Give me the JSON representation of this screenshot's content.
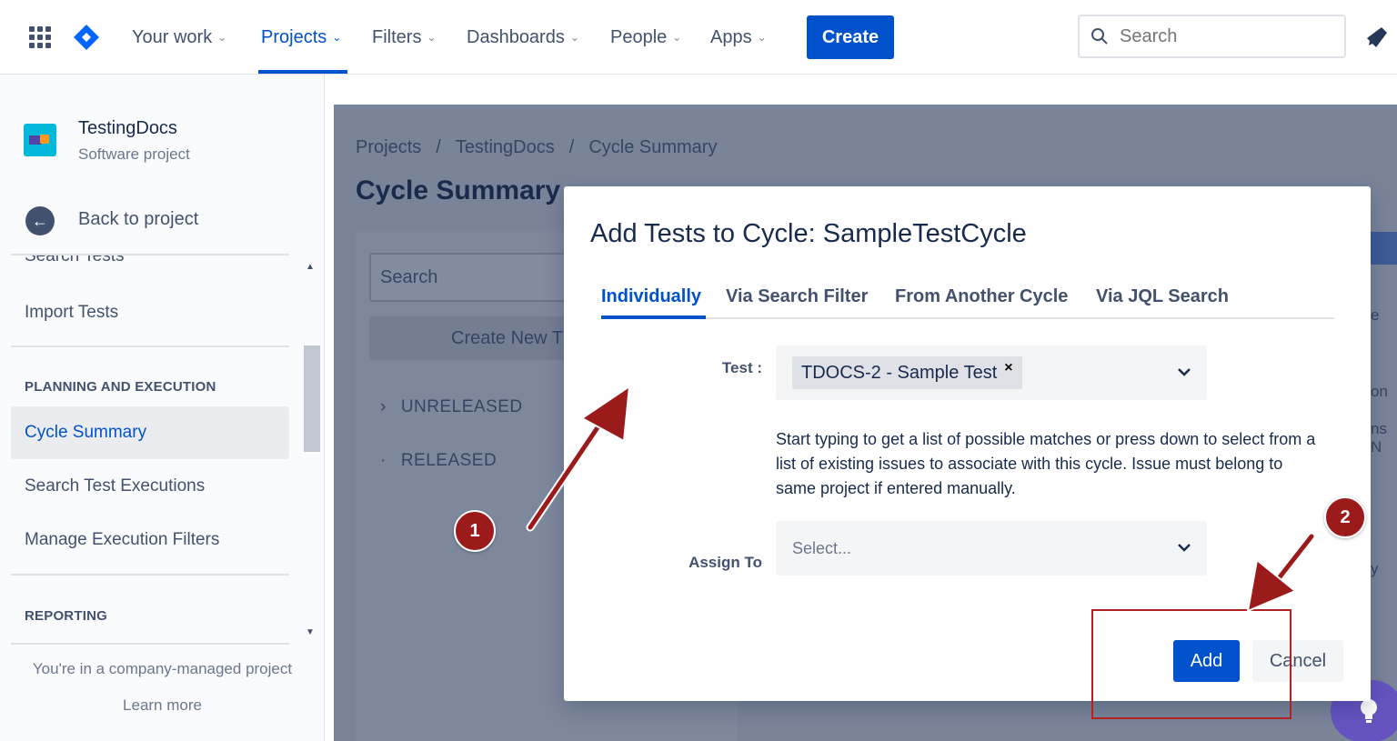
{
  "topnav": {
    "items": [
      {
        "label": "Your work",
        "active": false
      },
      {
        "label": "Projects",
        "active": true
      },
      {
        "label": "Filters",
        "active": false
      },
      {
        "label": "Dashboards",
        "active": false
      },
      {
        "label": "People",
        "active": false
      },
      {
        "label": "Apps",
        "active": false
      }
    ],
    "create_label": "Create",
    "search_placeholder": "Search",
    "accent_color": "#0052cc"
  },
  "sidebar": {
    "project_name": "TestingDocs",
    "project_type": "Software project",
    "back_label": "Back to project",
    "items": {
      "search_tests": "Search Tests",
      "import_tests": "Import Tests",
      "planning_heading": "PLANNING AND EXECUTION",
      "cycle_summary": "Cycle Summary",
      "search_test_executions": "Search Test Executions",
      "manage_execution_filters": "Manage Execution Filters",
      "reporting_heading": "REPORTING"
    },
    "footer_text": "You're in a company-managed project",
    "learn_more": "Learn more"
  },
  "main": {
    "breadcrumb": [
      "Projects",
      "TestingDocs",
      "Cycle Summary"
    ],
    "breadcrumb_sep": "/",
    "title": "Cycle Summary",
    "search_placeholder": "Search",
    "create_new_label": "Create New T",
    "tree": [
      {
        "marker": "›",
        "label": "UNRELEASED"
      },
      {
        "marker": "·",
        "label": "RELEASED"
      }
    ],
    "edge_fragments": [
      "e",
      "on",
      "ns N",
      "y"
    ]
  },
  "modal": {
    "title": "Add Tests to Cycle: SampleTestCycle",
    "tabs": [
      "Individually",
      "Via Search Filter",
      "From Another Cycle",
      "Via JQL Search"
    ],
    "active_tab": "Individually",
    "test_label": "Test :",
    "test_chip": "TDOCS-2 - Sample Test",
    "chip_remove": "×",
    "help_text": "Start typing to get a list of possible matches or press down to select from a list of existing issues to associate with this cycle. Issue must belong to same project if entered manually.",
    "assign_label": "Assign To",
    "assign_placeholder": "Select...",
    "add_label": "Add",
    "cancel_label": "Cancel"
  },
  "annotations": {
    "step1": "1",
    "step2": "2",
    "color": "#9b1b1b"
  }
}
